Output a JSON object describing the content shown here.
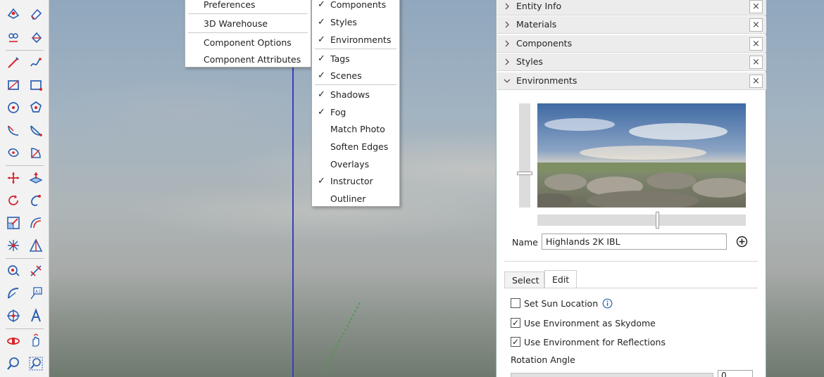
{
  "menu_left": {
    "items": [
      "Preferences",
      "3D Warehouse",
      "Component Options",
      "Component Attributes"
    ]
  },
  "menu_right": {
    "items": [
      {
        "label": "Components",
        "checked": true
      },
      {
        "label": "Styles",
        "checked": true
      },
      {
        "label": "Environments",
        "checked": true
      },
      {
        "label": "Tags",
        "checked": true
      },
      {
        "label": "Scenes",
        "checked": true
      },
      {
        "label": "Shadows",
        "checked": true
      },
      {
        "label": "Fog",
        "checked": true
      },
      {
        "label": "Match Photo",
        "checked": false
      },
      {
        "label": "Soften Edges",
        "checked": false
      },
      {
        "label": "Overlays",
        "checked": false
      },
      {
        "label": "Instructor",
        "checked": true
      },
      {
        "label": "Outliner",
        "checked": false
      }
    ],
    "check_glyph": "✓"
  },
  "tray": {
    "panels": [
      {
        "title": "Entity Info",
        "expanded": false
      },
      {
        "title": "Materials",
        "expanded": false
      },
      {
        "title": "Components",
        "expanded": false
      },
      {
        "title": "Styles",
        "expanded": false
      },
      {
        "title": "Environments",
        "expanded": true
      }
    ],
    "close_glyph": "×",
    "environments": {
      "name_label": "Name",
      "name_value": "Highlands 2K IBL",
      "tabs": [
        "Select",
        "Edit"
      ],
      "active_tab": "Edit",
      "options": [
        {
          "label": "Set Sun Location",
          "checked": false,
          "info": true
        },
        {
          "label": "Use Environment as Skydome",
          "checked": true
        },
        {
          "label": "Use Environment for Reflections",
          "checked": true
        }
      ],
      "rotation_label": "Rotation Angle",
      "rotation_value": "0"
    }
  },
  "colors": {
    "accent_red": "#d8232a",
    "accent_blue": "#2a5fb0",
    "axis_blue": "#3a3fbf",
    "axis_green": "#3da53d"
  }
}
